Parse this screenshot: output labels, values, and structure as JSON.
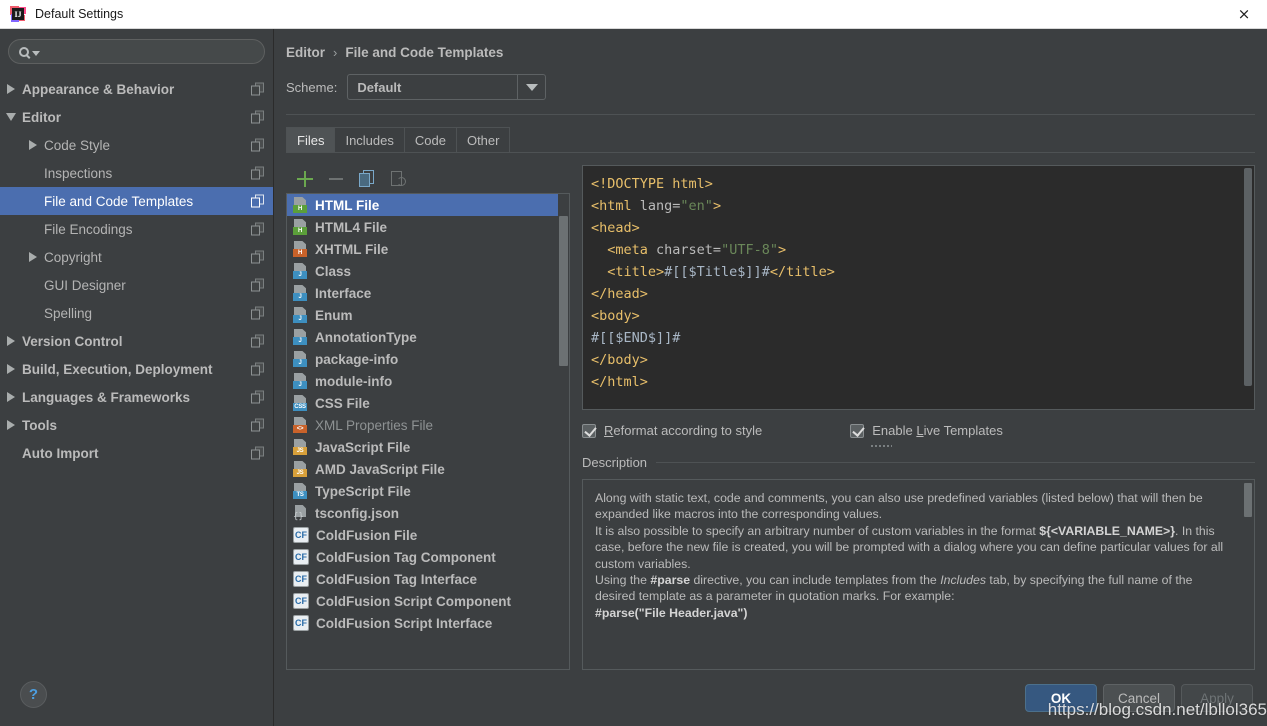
{
  "window": {
    "title": "Default Settings",
    "app_icon": "intellij-idea-icon",
    "close_label": "×"
  },
  "sidebar": {
    "search": {
      "placeholder": "",
      "value": "",
      "icon": "search-icon"
    },
    "items": [
      {
        "label": "Appearance & Behavior",
        "level": 0,
        "expander": "right",
        "selected": false
      },
      {
        "label": "Editor",
        "level": 0,
        "expander": "down",
        "selected": false
      },
      {
        "label": "Code Style",
        "level": 1,
        "expander": "right",
        "selected": false
      },
      {
        "label": "Inspections",
        "level": 1,
        "expander": "none",
        "selected": false
      },
      {
        "label": "File and Code Templates",
        "level": 1,
        "expander": "none",
        "selected": true
      },
      {
        "label": "File Encodings",
        "level": 1,
        "expander": "none",
        "selected": false
      },
      {
        "label": "Copyright",
        "level": 1,
        "expander": "right",
        "selected": false
      },
      {
        "label": "GUI Designer",
        "level": 1,
        "expander": "none",
        "selected": false
      },
      {
        "label": "Spelling",
        "level": 1,
        "expander": "none",
        "selected": false
      },
      {
        "label": "Version Control",
        "level": 0,
        "expander": "right",
        "selected": false
      },
      {
        "label": "Build, Execution, Deployment",
        "level": 0,
        "expander": "right",
        "selected": false
      },
      {
        "label": "Languages & Frameworks",
        "level": 0,
        "expander": "right",
        "selected": false
      },
      {
        "label": "Tools",
        "level": 0,
        "expander": "right",
        "selected": false
      },
      {
        "label": "Auto Import",
        "level": 0,
        "expander": "none",
        "selected": false
      }
    ],
    "help_label": "?"
  },
  "breadcrumb": {
    "parent": "Editor",
    "separator": "›",
    "current": "File and Code Templates"
  },
  "scheme": {
    "label": "Scheme:",
    "value": "Default"
  },
  "tabs": [
    {
      "label": "Files",
      "active": true
    },
    {
      "label": "Includes",
      "active": false
    },
    {
      "label": "Code",
      "active": false
    },
    {
      "label": "Other",
      "active": false
    }
  ],
  "list_toolbar": [
    {
      "name": "add-template-button",
      "icon": "plus-icon",
      "enabled": true
    },
    {
      "name": "remove-template-button",
      "icon": "minus-icon",
      "enabled": false
    },
    {
      "name": "copy-template-button",
      "icon": "copy-icon",
      "enabled": true
    },
    {
      "name": "reset-template-button",
      "icon": "reset-icon",
      "enabled": false
    }
  ],
  "file_list": {
    "selected_index": 0,
    "items": [
      {
        "label": "HTML File",
        "badge": "H",
        "badge_color": "#5b9f3a",
        "kind": "page"
      },
      {
        "label": "HTML4 File",
        "badge": "H",
        "badge_color": "#5b9f3a",
        "kind": "page"
      },
      {
        "label": "XHTML File",
        "badge": "H",
        "badge_color": "#c9622a",
        "kind": "page"
      },
      {
        "label": "Class",
        "badge": "J",
        "badge_color": "#3d8fc0",
        "kind": "page"
      },
      {
        "label": "Interface",
        "badge": "J",
        "badge_color": "#3d8fc0",
        "kind": "page"
      },
      {
        "label": "Enum",
        "badge": "J",
        "badge_color": "#3d8fc0",
        "kind": "page"
      },
      {
        "label": "AnnotationType",
        "badge": "J",
        "badge_color": "#3d8fc0",
        "kind": "page"
      },
      {
        "label": "package-info",
        "badge": "J",
        "badge_color": "#3d8fc0",
        "kind": "page"
      },
      {
        "label": "module-info",
        "badge": "J",
        "badge_color": "#3d8fc0",
        "kind": "page"
      },
      {
        "label": "CSS File",
        "badge": "CSS",
        "badge_color": "#3d8fc0",
        "kind": "page"
      },
      {
        "label": "XML Properties File",
        "badge": "<>",
        "badge_color": "#c9622a",
        "kind": "page",
        "dim": true
      },
      {
        "label": "JavaScript File",
        "badge": "JS",
        "badge_color": "#d8a03a",
        "kind": "page"
      },
      {
        "label": "AMD JavaScript File",
        "badge": "JS",
        "badge_color": "#d8a03a",
        "kind": "page"
      },
      {
        "label": "TypeScript File",
        "badge": "TS",
        "badge_color": "#3d8fc0",
        "kind": "page"
      },
      {
        "label": "tsconfig.json",
        "badge": "{}",
        "badge_color": "#00000000",
        "kind": "json"
      },
      {
        "label": "ColdFusion File",
        "badge": "CF",
        "badge_color": "#2a6ca8",
        "kind": "cf"
      },
      {
        "label": "ColdFusion Tag Component",
        "badge": "CF",
        "badge_color": "#2a6ca8",
        "kind": "cf"
      },
      {
        "label": "ColdFusion Tag Interface",
        "badge": "CF",
        "badge_color": "#2a6ca8",
        "kind": "cf"
      },
      {
        "label": "ColdFusion Script Component",
        "badge": "CF",
        "badge_color": "#2a6ca8",
        "kind": "cf"
      },
      {
        "label": "ColdFusion Script Interface",
        "badge": "CF",
        "badge_color": "#2a6ca8",
        "kind": "cf"
      }
    ]
  },
  "editor": {
    "lines": [
      [
        {
          "t": "<!DOCTYPE html>",
          "c": "tg"
        }
      ],
      [
        {
          "t": "<html ",
          "c": "tg"
        },
        {
          "t": "lang=",
          "c": "at"
        },
        {
          "t": "\"en\"",
          "c": "st"
        },
        {
          "t": ">",
          "c": "tg"
        }
      ],
      [
        {
          "t": "<head>",
          "c": "tg"
        }
      ],
      [
        {
          "t": "  <meta ",
          "c": "tg"
        },
        {
          "t": "charset=",
          "c": "at"
        },
        {
          "t": "\"UTF-8\"",
          "c": "st"
        },
        {
          "t": ">",
          "c": "tg"
        }
      ],
      [
        {
          "t": "  <title>",
          "c": "tg"
        },
        {
          "t": "#[[$Title$]]#",
          "c": "pl"
        },
        {
          "t": "</title>",
          "c": "tg"
        }
      ],
      [
        {
          "t": "</head>",
          "c": "tg"
        }
      ],
      [
        {
          "t": "<body>",
          "c": "tg"
        }
      ],
      [
        {
          "t": "#[[$END$]]#",
          "c": "pl"
        }
      ],
      [
        {
          "t": "</body>",
          "c": "tg"
        }
      ],
      [
        {
          "t": "</html>",
          "c": "tg"
        }
      ]
    ]
  },
  "options": {
    "reformat": {
      "label_pre": "",
      "label_mnemonic": "R",
      "label_post": "eformat according to style",
      "checked": true
    },
    "live_templates": {
      "label_pre": "Enable ",
      "label_mnemonic": "L",
      "label_post": "ive Templates",
      "checked": true
    }
  },
  "description": {
    "title": "Description",
    "paragraphs": [
      [
        {
          "t": "Along with static text, code and comments, you can also use predefined variables (listed below) that will then be expanded like macros into the corresponding values.",
          "s": "n"
        }
      ],
      [
        {
          "t": "It is also possible to specify an arbitrary number of custom variables in the format ",
          "s": "n"
        },
        {
          "t": "${<VARIABLE_NAME>}",
          "s": "b"
        },
        {
          "t": ". In this case, before the new file is created, you will be prompted with a dialog where you can define particular values for all custom variables.",
          "s": "n"
        }
      ],
      [
        {
          "t": "Using the ",
          "s": "n"
        },
        {
          "t": "#parse",
          "s": "b"
        },
        {
          "t": " directive, you can include templates from the ",
          "s": "n"
        },
        {
          "t": "Includes",
          "s": "i"
        },
        {
          "t": " tab, by specifying the full name of the desired template as a parameter in quotation marks. For example:",
          "s": "n"
        }
      ],
      [
        {
          "t": "#parse(\"File Header.java\")",
          "s": "b"
        }
      ]
    ]
  },
  "footer": {
    "ok": "OK",
    "cancel": "Cancel",
    "apply": "Apply",
    "apply_enabled": false
  },
  "watermark": "https://blog.csdn.net/lbllol365",
  "colors": {
    "accent_selection": "#4b6eaf",
    "primary_button": "#365880",
    "panel_bg": "#3c3f41",
    "editor_bg": "#2b2b2b",
    "text": "#bbbbbb"
  }
}
